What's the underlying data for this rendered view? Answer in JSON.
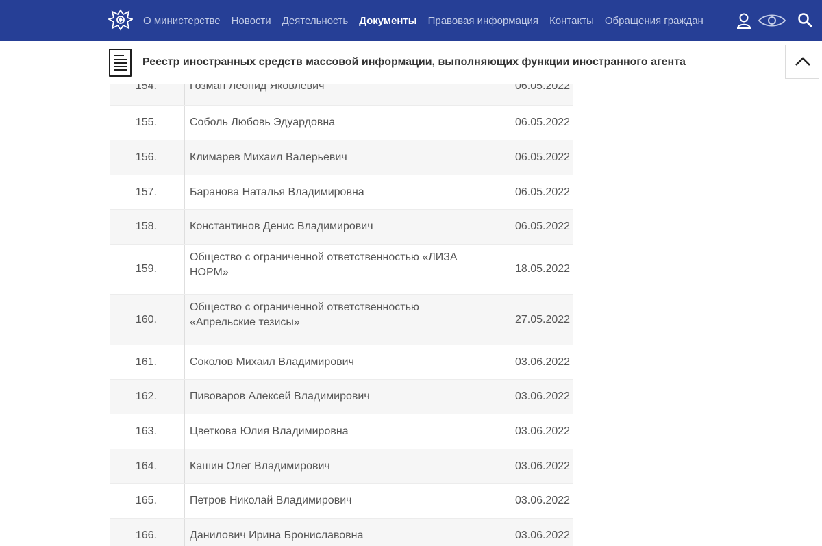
{
  "nav": {
    "items": [
      {
        "label": "О министерстве",
        "active": false
      },
      {
        "label": "Новости",
        "active": false
      },
      {
        "label": "Деятельность",
        "active": false
      },
      {
        "label": "Документы",
        "active": true
      },
      {
        "label": "Правовая информация",
        "active": false
      },
      {
        "label": "Контакты",
        "active": false
      },
      {
        "label": "Обращения граждан",
        "active": false
      }
    ]
  },
  "header": {
    "title": "Реестр иностранных средств массовой информации, выполняющих функции иностранного агента"
  },
  "table": {
    "rows": [
      {
        "num": "154.",
        "name": "Гозман Леонид Яковлевич",
        "date": "06.05.2022"
      },
      {
        "num": "155.",
        "name": "Соболь Любовь Эдуардовна",
        "date": "06.05.2022"
      },
      {
        "num": "156.",
        "name": "Климарев Михаил Валерьевич",
        "date": "06.05.2022"
      },
      {
        "num": "157.",
        "name": "Баранова Наталья Владимировна",
        "date": "06.05.2022"
      },
      {
        "num": "158.",
        "name": "Константинов Денис Владимирович",
        "date": "06.05.2022"
      },
      {
        "num": "159.",
        "name": "Общество с ограниченной ответственностью «ЛИЗА НОРМ»",
        "date": "18.05.2022"
      },
      {
        "num": "160.",
        "name": "Общество с ограниченной ответственностью «Апрельские тезисы»",
        "date": "27.05.2022"
      },
      {
        "num": "161.",
        "name": "Соколов Михаил Владимирович",
        "date": "03.06.2022"
      },
      {
        "num": "162.",
        "name": "Пивоваров Алексей Владимирович",
        "date": "03.06.2022"
      },
      {
        "num": "163.",
        "name": "Цветкова Юлия Владимировна",
        "date": "03.06.2022"
      },
      {
        "num": "164.",
        "name": "Кашин Олег Владимирович",
        "date": "03.06.2022"
      },
      {
        "num": "165.",
        "name": "Петров Николай Владимирович",
        "date": "03.06.2022"
      },
      {
        "num": "166.",
        "name": "Данилович Ирина Брониславовна",
        "date": "03.06.2022"
      }
    ]
  }
}
